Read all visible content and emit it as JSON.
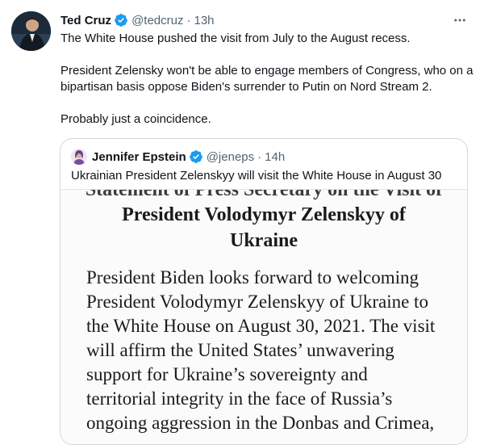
{
  "tweet": {
    "author_name": "Ted Cruz",
    "handle": "@tedcruz",
    "separator": "·",
    "time": "13h",
    "paragraphs": [
      "The White House pushed the visit from July to the August recess.",
      "President Zelensky won't be able to engage members of Congress, who on a bipartisan basis oppose Biden's surrender to Putin on Nord Stream 2.",
      "Probably just a coincidence."
    ]
  },
  "quoted": {
    "author_name": "Jennifer Epstein",
    "handle": "@jeneps",
    "separator": "·",
    "time": "14h",
    "text": "Ukrainian President Zelenskyy will visit the White House in August 30",
    "image": {
      "cut_heading": "Statement of Press Secretary on the Visit of",
      "heading_line1": "President Volodymyr Zelenskyy of",
      "heading_line2": "Ukraine",
      "body_lines": [
        "President Biden looks forward to welcoming",
        "President Volodymyr Zelenskyy of Ukraine to",
        "the White House on August 30, 2021. The visit",
        "will affirm the United States’ unwavering",
        "support for Ukraine’s sovereignty and",
        "territorial integrity in the face of Russia’s",
        "ongoing aggression in the Donbas and Crimea,"
      ]
    }
  },
  "icons": {
    "verified": "verified-badge-icon",
    "more": "more-options-icon"
  },
  "colors": {
    "verified": "#1d9bf0",
    "muted_text": "#536471",
    "border": "#cfd9de"
  }
}
